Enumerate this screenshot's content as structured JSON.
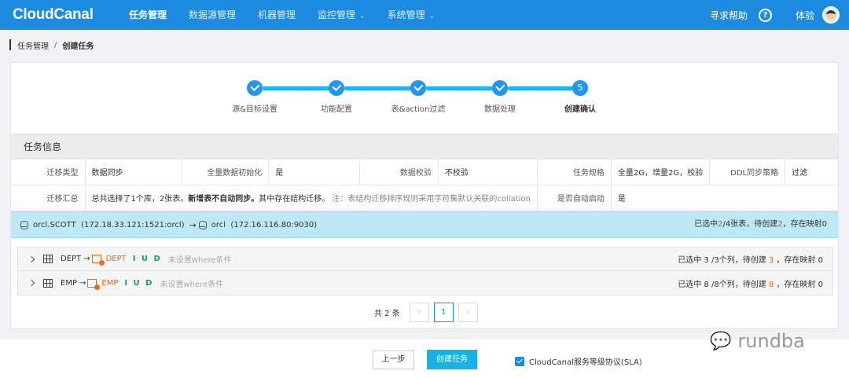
{
  "app": {
    "logo": "CloudCanal"
  },
  "nav": {
    "items": [
      {
        "label": "任务管理",
        "active": true,
        "dropdown": false
      },
      {
        "label": "数据源管理",
        "active": false,
        "dropdown": false
      },
      {
        "label": "机器管理",
        "active": false,
        "dropdown": false
      },
      {
        "label": "监控管理",
        "active": false,
        "dropdown": true
      },
      {
        "label": "系统管理",
        "active": false,
        "dropdown": true
      }
    ],
    "help": "寻求帮助",
    "help_icon": "question-circle-icon",
    "user": "体验"
  },
  "breadcrumb": {
    "parent": "任务管理",
    "sep": "/",
    "current": "创建任务"
  },
  "steps": [
    {
      "label": "源&目标设置",
      "status": "done"
    },
    {
      "label": "功能配置",
      "status": "done"
    },
    {
      "label": "表&action过滤",
      "status": "done"
    },
    {
      "label": "数据处理",
      "status": "done"
    },
    {
      "label": "创建确认",
      "status": "current",
      "number": "5"
    }
  ],
  "task_info": {
    "title": "任务信息",
    "row1": {
      "migrate_type_label": "迁移类型",
      "migrate_type": "数据同步",
      "init_label": "全量数据初始化",
      "init": "是",
      "verify_label": "数据校验",
      "verify": "不校验",
      "spec_label": "任务规格",
      "spec": "全量2G，增量2G，校验",
      "ddl_label": "DDL同步策略",
      "ddl": "过滤"
    },
    "row2": {
      "summary_label": "迁移汇总",
      "summary_a": "总共选择了1个库，2张表。",
      "summary_b": "新增表不自动同步。",
      "summary_c": "其中存在结构迁移。",
      "summary_note": "注：表结构迁移排序规则采用字符集默认关联的collation",
      "autostart_label": "是否自动启动",
      "autostart": "是"
    }
  },
  "db_bar": {
    "source": "orcl.SCOTT",
    "source_addr": "(172.18.33.121:1521:orcl)",
    "target": "orcl",
    "target_addr": "(172.16.116.80:9030)",
    "summary_a": "已选中",
    "selected": "2",
    "summary_b": "/4张表，待创建",
    "to_create": "2",
    "summary_c": "，存在映射0"
  },
  "tables": [
    {
      "src": "DEPT",
      "dst": "DEPT",
      "ops": "I U D",
      "cond": "未设置where条件",
      "status_a": "已选中 3 /3个列，待创建",
      "to_create": "3",
      "status_b": "，存在映射 0"
    },
    {
      "src": "EMP",
      "dst": "EMP",
      "ops": "I U D",
      "cond": "未设置where条件",
      "status_a": "已选中 8 /8个列，待创建",
      "to_create": "8",
      "status_b": "，存在映射 0"
    }
  ],
  "pager": {
    "total": "共 2 条",
    "prev": "‹",
    "page": "1",
    "next": "›"
  },
  "footer": {
    "prev_label": "上一步",
    "create_label": "创建任务",
    "sla_label": "CloudCanal服务等级协议(SLA)",
    "sla_checked": true
  },
  "watermark": {
    "icon": "wechat-icon",
    "text": "rundba"
  },
  "colors": {
    "primary": "#1c8be0",
    "step_line": "#18b6e6",
    "db_bar": "#bde9f7",
    "highlight": "#e4493b",
    "target": "#ef6c1f",
    "ops": "#18a34a"
  }
}
